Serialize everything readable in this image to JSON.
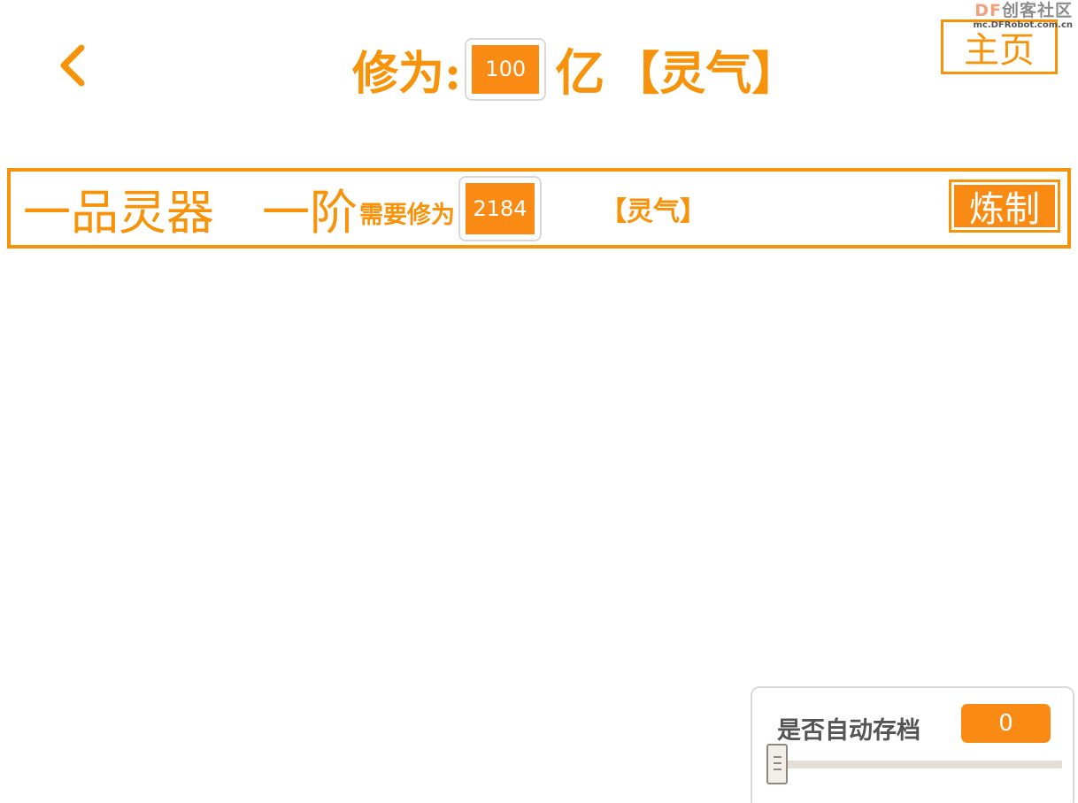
{
  "watermark": {
    "brand_prefix": "DF",
    "brand_suffix": "创客社区",
    "url": "mc.DFRobot.com.cn"
  },
  "header": {
    "back_icon": "chevron-left-icon",
    "cultivation_label": "修为:",
    "cultivation_value": "100",
    "cultivation_unit": "亿",
    "cultivation_suffix": "【灵气】",
    "home_label": "主页"
  },
  "item": {
    "name": "一品灵器",
    "tier": "一阶",
    "requirement_label": "需要修为",
    "requirement_value": "2184",
    "requirement_unit": "【灵气】",
    "refine_label": "炼制"
  },
  "autosave": {
    "label": "是否自动存档",
    "value": "0",
    "slider_level": 0
  },
  "colors": {
    "accent": "#f7930a",
    "value_fill": "#f98b14",
    "panel_text": "#555555",
    "border_gray": "#d9d9d9"
  }
}
